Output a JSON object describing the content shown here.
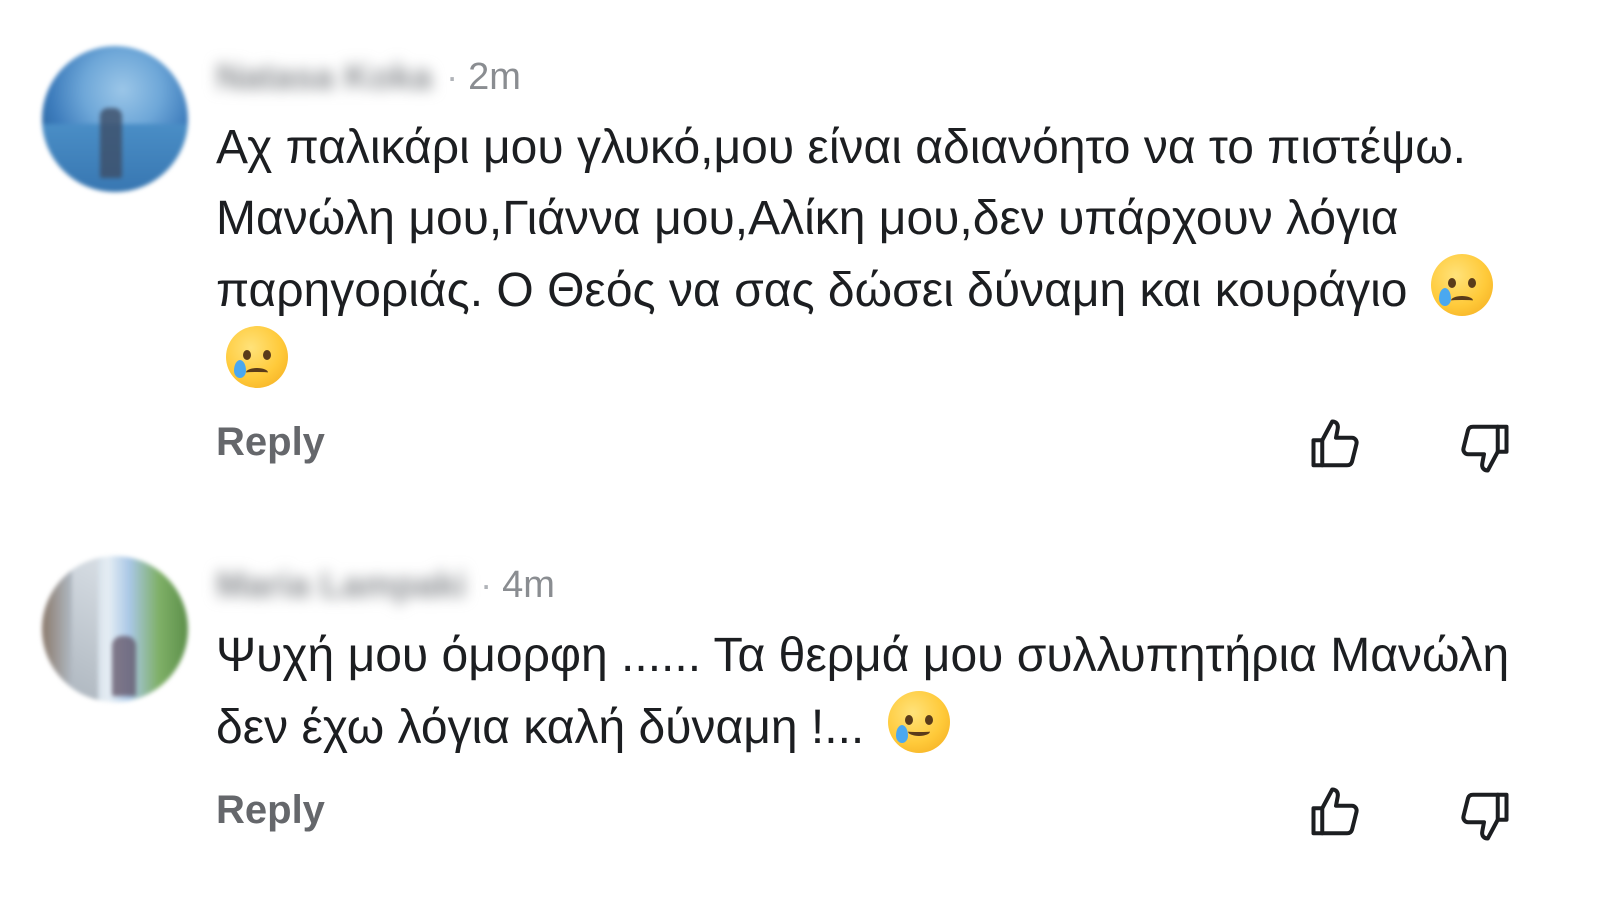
{
  "comments": [
    {
      "author_name": "Natasa Koka",
      "separator": "·",
      "time": "2m",
      "text": "Αχ παλικάρι μου γλυκό,μου είναι αδιανόητο να το πιστέψω. Μανώλη μου,Γιάννα μου,Αλίκη μου,δεν υπάρχουν λόγια παρηγοριάς. Ο Θεός να σας δώσει δύναμη και κουράγιο",
      "emojis": [
        "crying-face",
        "crying-face"
      ],
      "reply_label": "Reply",
      "like_icon": "thumbs-up-icon",
      "dislike_icon": "thumbs-down-icon"
    },
    {
      "author_name": "Maria Lampaki",
      "separator": "·",
      "time": "4m",
      "text": "Ψυχή μου όμορφη ...... Τα θερμά μου συλλυπητήρια Μανώλη δεν έχω λόγια καλή δύναμη !...",
      "emojis": [
        "smiling-face-with-tear"
      ],
      "reply_label": "Reply",
      "like_icon": "thumbs-up-icon",
      "dislike_icon": "thumbs-down-icon"
    }
  ],
  "colors": {
    "text": "#1c1e21",
    "meta": "#8a8d91",
    "reply": "#65676b",
    "background": "#ffffff"
  }
}
